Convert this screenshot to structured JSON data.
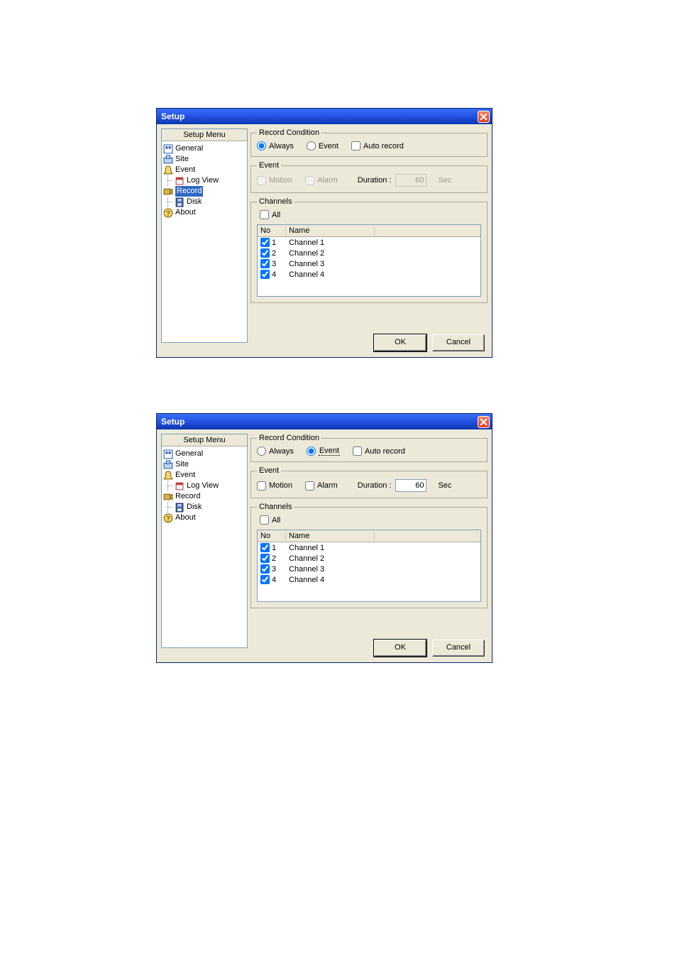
{
  "dialogs": [
    {
      "title": "Setup",
      "sidebar_header": "Setup Menu",
      "tree": {
        "general": "General",
        "site": "Site",
        "event": "Event",
        "logview": "Log View",
        "record": "Record",
        "disk": "Disk",
        "about": "About"
      },
      "selected_tree": "record",
      "groups": {
        "record_condition": "Record Condition",
        "event": "Event",
        "channels": "Channels"
      },
      "record_condition": {
        "always": "Always",
        "event": "Event",
        "auto": "Auto record",
        "selected": "always"
      },
      "event": {
        "motion": "Motion",
        "alarm": "Alarm",
        "duration_label": "Duration :",
        "duration_value": "60",
        "sec": "Sec",
        "enabled": false
      },
      "channels": {
        "all": "All",
        "col_no": "No",
        "col_name": "Name",
        "rows": [
          {
            "no": "1",
            "name": "Channel 1",
            "checked": true
          },
          {
            "no": "2",
            "name": "Channel 2",
            "checked": true
          },
          {
            "no": "3",
            "name": "Channel 3",
            "checked": true
          },
          {
            "no": "4",
            "name": "Channel 4",
            "checked": true
          }
        ]
      },
      "buttons": {
        "ok": "OK",
        "cancel": "Cancel"
      }
    },
    {
      "title": "Setup",
      "sidebar_header": "Setup Menu",
      "tree": {
        "general": "General",
        "site": "Site",
        "event": "Event",
        "logview": "Log View",
        "record": "Record",
        "disk": "Disk",
        "about": "About"
      },
      "selected_tree": "none",
      "groups": {
        "record_condition": "Record Condition",
        "event": "Event",
        "channels": "Channels"
      },
      "record_condition": {
        "always": "Always",
        "event": "Event",
        "auto": "Auto record",
        "selected": "event"
      },
      "event": {
        "motion": "Motion",
        "alarm": "Alarm",
        "duration_label": "Duration :",
        "duration_value": "60",
        "sec": "Sec",
        "enabled": true
      },
      "channels": {
        "all": "All",
        "col_no": "No",
        "col_name": "Name",
        "rows": [
          {
            "no": "1",
            "name": "Channel 1",
            "checked": true
          },
          {
            "no": "2",
            "name": "Channel 2",
            "checked": true
          },
          {
            "no": "3",
            "name": "Channel 3",
            "checked": true
          },
          {
            "no": "4",
            "name": "Channel 4",
            "checked": true
          }
        ]
      },
      "buttons": {
        "ok": "OK",
        "cancel": "Cancel"
      }
    }
  ]
}
